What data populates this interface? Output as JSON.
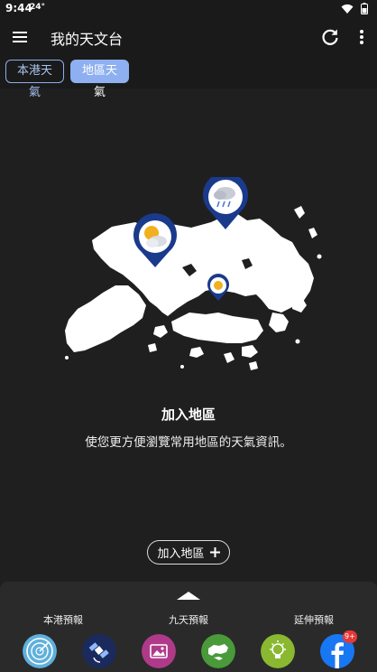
{
  "status_bar": {
    "time": "9:44",
    "temperature": "24°",
    "icons": [
      "wifi-icon",
      "battery-icon"
    ]
  },
  "app_bar": {
    "title": "我的天文台",
    "icons": [
      "menu-icon",
      "refresh-icon",
      "more-vert-icon"
    ]
  },
  "tabs": [
    {
      "label": "本港天氣",
      "selected": false
    },
    {
      "label": "地區天氣",
      "selected": true
    }
  ],
  "empty_state": {
    "title": "加入地區",
    "description": "使您更方便瀏覽常用地區的天氣資訊。",
    "add_button_label": "加入地區"
  },
  "bottom_sheet": {
    "labels": [
      "本港預報",
      "九天預報",
      "延伸預報"
    ],
    "notification_badge": "9+"
  },
  "colors": {
    "background": "#1f1f1f",
    "accent": "#8fb0f0",
    "pin": "#1a3a8c"
  }
}
